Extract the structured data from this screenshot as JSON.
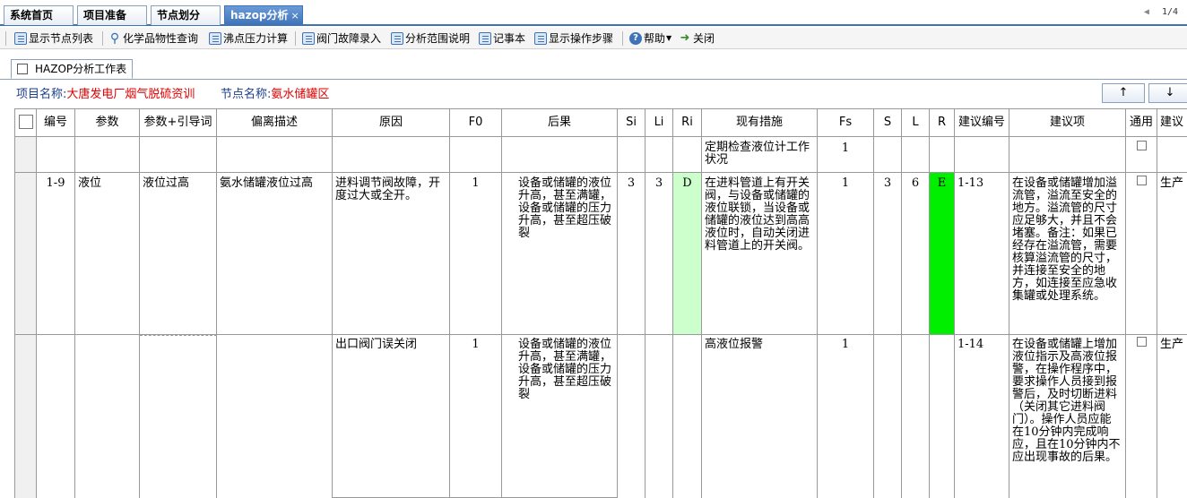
{
  "tabs": [
    {
      "label": "系统首页"
    },
    {
      "label": "项目准备"
    },
    {
      "label": "节点划分"
    },
    {
      "label": "hazop分析",
      "close": "×"
    }
  ],
  "pager": {
    "arrow": "◀",
    "text": "1/4"
  },
  "toolbar": {
    "show_nodes": "显示节点列表",
    "chem_query": "化学品物性查询",
    "boiling_calc": "沸点压力计算",
    "valve_fault": "阀门故障录入",
    "analysis_scope": "分析范围说明",
    "notepad": "记事本",
    "show_steps": "显示操作步骤",
    "help": "帮助",
    "close": "关闭"
  },
  "worktab": {
    "label": "HAZOP分析工作表"
  },
  "info": {
    "project_label": "项目名称:",
    "project_value": "大唐发电厂烟气脱硫资训",
    "node_label": "节点名称:",
    "node_value": "氨水储罐区"
  },
  "nav": {
    "up": "↑",
    "down": "↓"
  },
  "table": {
    "headers": {
      "num": "编号",
      "param": "参数",
      "param_guide": "参数+引导词",
      "deviation": "偏离描述",
      "cause": "原因",
      "f0": "F0",
      "consequence": "后果",
      "si": "Si",
      "li": "Li",
      "ri": "Ri",
      "measures": "现有措施",
      "fs": "Fs",
      "s": "S",
      "l": "L",
      "r": "R",
      "sugg_num": "建议编号",
      "sugg": "建议项",
      "common": "通用",
      "sugg2": "建议"
    },
    "row0": {
      "measures": "定期检查液位计工作状况",
      "fs": "1"
    },
    "row1": {
      "num": "1-9",
      "param": "液位",
      "param_guide": "液位过高",
      "deviation": "氨水储罐液位过高",
      "cause": "进料调节阀故障，开度过大或全开。",
      "f0": "1",
      "consequence": "设备或储罐的液位升高，甚至满罐，设备或储罐的压力升高，甚至超压破裂",
      "si": "3",
      "li": "3",
      "ri": "D",
      "measures": "在进料管道上有开关阀，与设备或储罐的液位联锁，当设备或储罐的液位达到高高液位时，自动关闭进料管道上的开关阀。",
      "fs": "1",
      "s": "3",
      "l": "6",
      "r": "E",
      "sugg_num": "1-13",
      "sugg": "在设备或储罐增加溢流管，溢流至安全的地方。溢流管的尺寸应足够大，并且不会堵塞。备注：如果已经存在溢流管，需要核算溢流管的尺寸，并连接至安全的地方，如连接至应急收集罐或处理系统。",
      "sugg2": "生产"
    },
    "row2": {
      "cause": "出口阀门误关闭",
      "f0": "1",
      "consequence": "设备或储罐的液位升高，甚至满罐，设备或储罐的压力升高，甚至超压破裂",
      "measures": "高液位报警",
      "fs": "1",
      "sugg_num": "1-14",
      "sugg": "在设备或储罐上增加液位指示及高液位报警，在操作程序中，要求操作人员接到报警后，及时切断进料（关闭其它进料阀门）。操作人员应能在10分钟内完成响应，且在10分钟内不应出现事故的后果。",
      "sugg2": "生产"
    }
  },
  "colors": {
    "ri_bg": "#ccffcc",
    "r_bg": "#00ee00",
    "accent": "#3f73b8"
  }
}
